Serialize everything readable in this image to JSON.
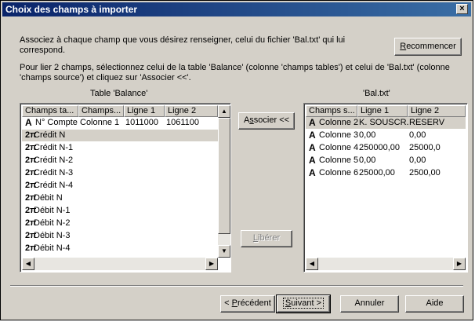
{
  "window": {
    "title": "Choix des champs à importer",
    "close_label": "×"
  },
  "instructions": {
    "line1": "Associez à chaque champ que vous désirez renseigner, celui du fichier 'Bal.txt' qui lui",
    "line2": "correspond.",
    "line3": "Pour lier 2 champs, sélectionnez celui de la table 'Balance' (colonne 'champs tables') et celui de 'Bal.txt' (colonne",
    "line4": "'champs source') et cliquez sur 'Associer <<'."
  },
  "buttons": {
    "recommencer": {
      "pre": "",
      "u": "R",
      "post": "ecommencer"
    },
    "associer": {
      "pre": "A",
      "u": "s",
      "post": "socier <<"
    },
    "liberer": {
      "pre": "",
      "u": "L",
      "post": "ibérer"
    },
    "precedent": {
      "pre": "< ",
      "u": "P",
      "post": "récédent"
    },
    "suivant": {
      "pre": "",
      "u": "S",
      "post": "uivant >"
    },
    "annuler": "Annuler",
    "aide": "Aide"
  },
  "left_table": {
    "caption": "Table 'Balance'",
    "headers": [
      "Champs ta...",
      "Champs...",
      "Ligne 1",
      "Ligne 2"
    ],
    "rows": [
      {
        "icon": "A",
        "name": "N° Compte",
        "source": "Colonne 1",
        "l1": "1011000",
        "l2": "1061100",
        "selected": false
      },
      {
        "icon": "2π",
        "name": "Crédit N",
        "source": "",
        "l1": "",
        "l2": "",
        "selected": true
      },
      {
        "icon": "2π",
        "name": "Crédit N-1",
        "source": "",
        "l1": "",
        "l2": "",
        "selected": false
      },
      {
        "icon": "2π",
        "name": "Crédit N-2",
        "source": "",
        "l1": "",
        "l2": "",
        "selected": false
      },
      {
        "icon": "2π",
        "name": "Crédit N-3",
        "source": "",
        "l1": "",
        "l2": "",
        "selected": false
      },
      {
        "icon": "2π",
        "name": "Crédit N-4",
        "source": "",
        "l1": "",
        "l2": "",
        "selected": false
      },
      {
        "icon": "2π",
        "name": "Débit N",
        "source": "",
        "l1": "",
        "l2": "",
        "selected": false
      },
      {
        "icon": "2π",
        "name": "Débit N-1",
        "source": "",
        "l1": "",
        "l2": "",
        "selected": false
      },
      {
        "icon": "2π",
        "name": "Débit N-2",
        "source": "",
        "l1": "",
        "l2": "",
        "selected": false
      },
      {
        "icon": "2π",
        "name": "Débit N-3",
        "source": "",
        "l1": "",
        "l2": "",
        "selected": false
      },
      {
        "icon": "2π",
        "name": "Débit N-4",
        "source": "",
        "l1": "",
        "l2": "",
        "selected": false
      }
    ]
  },
  "right_table": {
    "caption": "'Bal.txt'",
    "headers": [
      "Champs s...",
      "Ligne 1",
      "Ligne 2"
    ],
    "rows": [
      {
        "icon": "A",
        "name": "Colonne 2",
        "l1": "K. SOUSCR...",
        "l2": "RESERV",
        "selected": true
      },
      {
        "icon": "A",
        "name": "Colonne 3",
        "l1": "0,00",
        "l2": "0,00",
        "selected": false
      },
      {
        "icon": "A",
        "name": "Colonne 4",
        "l1": "250000,00",
        "l2": "25000,0",
        "selected": false
      },
      {
        "icon": "A",
        "name": "Colonne 5",
        "l1": "0,00",
        "l2": "0,00",
        "selected": false
      },
      {
        "icon": "A",
        "name": "Colonne 6",
        "l1": "25000,00",
        "l2": "2500,00",
        "selected": false
      }
    ]
  },
  "icons": {
    "text_type": "text-type-icon",
    "numeric_type": "numeric-type-icon",
    "scroll_up": "▲",
    "scroll_down": "▼",
    "scroll_left": "◀",
    "scroll_right": "▶"
  }
}
